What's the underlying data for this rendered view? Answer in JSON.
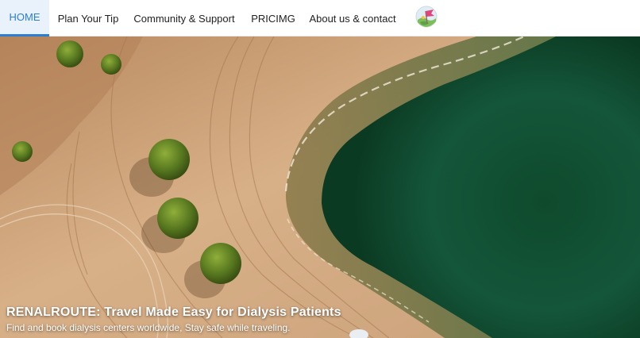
{
  "nav": {
    "items": [
      {
        "label": "HOME",
        "active": true
      },
      {
        "label": "Plan Your Tip",
        "active": false
      },
      {
        "label": "Community & Support",
        "active": false
      },
      {
        "label": "PRICIMG",
        "active": false
      },
      {
        "label": "About us & contact",
        "active": false
      }
    ],
    "logo_icon": "globe-flag-icon",
    "accent_color": "#2a7fd4"
  },
  "hero": {
    "title": "RENALROUTE:  Travel Made Easy for Dialysis Patients",
    "subtitle": "Find and book dialysis centers worldwide, Stay safe while traveling.",
    "image": "aerial-beach-lagoon-image"
  }
}
